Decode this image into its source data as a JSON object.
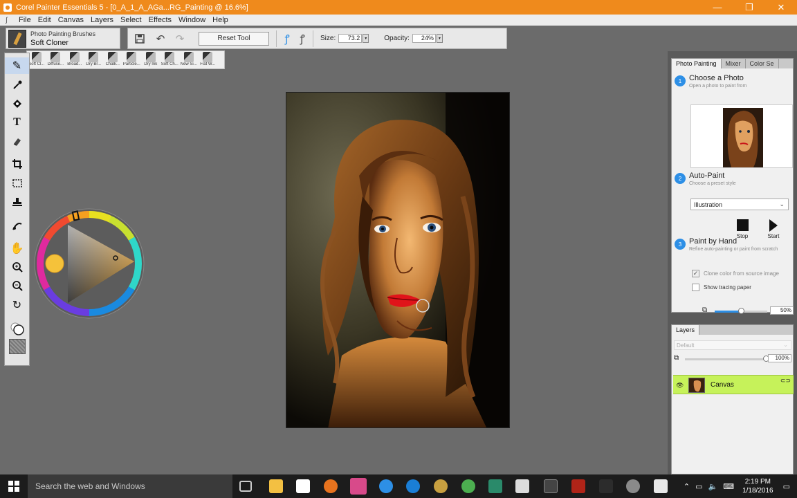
{
  "window": {
    "title": "Corel Painter Essentials 5 - [0_A_1_A_AGa...RG_Painting @ 16.6%]",
    "minimize": "—",
    "maximize": "❐",
    "close": "✕"
  },
  "menu": [
    "File",
    "Edit",
    "Canvas",
    "Layers",
    "Select",
    "Effects",
    "Window",
    "Help"
  ],
  "property_bar": {
    "brush_category": "Photo Painting Brushes",
    "brush_variant": "Soft Cloner",
    "reset_label": "Reset Tool",
    "size_label": "Size:",
    "size_value": "73.2",
    "opacity_label": "Opacity:",
    "opacity_value": "24%"
  },
  "variants": [
    "Soft Cl...",
    "Diffuse...",
    "Broad...",
    "Dry Br...",
    "Chalk...",
    "Particle...",
    "Dry Ink",
    "Soft Ch...",
    "New Si...",
    "Flat W..."
  ],
  "tools": [
    "brush-tool",
    "dropper-tool",
    "paint-bucket-tool",
    "text-tool",
    "eraser-tool",
    "crop-tool",
    "rectangular-selection-tool",
    "stamp-tool",
    "cloner-tool",
    "grabber-tool",
    "magnifier-in-tool",
    "magnifier-out-tool",
    "rotate-page-tool"
  ],
  "colors": {
    "accent": "#ef8a1c",
    "selected_color": "#f5c23a",
    "layer_highlight": "#c6f25a",
    "step_blue": "#2d8fe6"
  },
  "photo_panel": {
    "tabs": [
      "Photo Painting",
      "Mixer",
      "Color Se"
    ],
    "step1_num": "1",
    "step1_title": "Choose a Photo",
    "step1_sub": "Open a photo to paint from",
    "step2_num": "2",
    "step2_title": "Auto-Paint",
    "step2_sub": "Choose a preset style",
    "style_value": "Illustration",
    "stop_label": "Stop",
    "start_label": "Start",
    "step3_num": "3",
    "step3_title": "Paint by Hand",
    "step3_sub": "Refine auto-painting or paint from scratch",
    "clone_color_label": "Clone color from source image",
    "clone_color_checked": true,
    "tracing_label": "Show tracing paper",
    "tracing_checked": false,
    "tracing_opacity": "50%",
    "tracing_opacity_fraction": 0.5
  },
  "layers_panel": {
    "tab": "Layers",
    "blend_mode": "Default",
    "opacity": "100%",
    "opacity_fraction": 1.0,
    "layer_name": "Canvas"
  },
  "taskbar": {
    "search_placeholder": "Search the web and Windows",
    "time": "2:19 PM",
    "date": "1/18/2016"
  }
}
